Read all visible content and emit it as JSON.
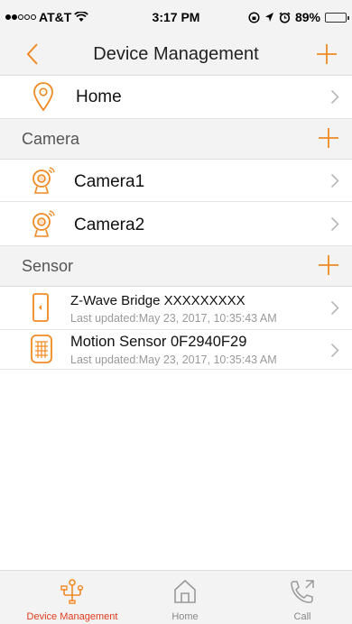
{
  "status": {
    "carrier": "AT&T",
    "time": "3:17 PM",
    "battery": "89%",
    "signal_bars_filled": 2,
    "signal_bars_total": 5,
    "battery_level": 0.89
  },
  "nav": {
    "title": "Device Management",
    "back_icon": "chevron-left-icon",
    "add_icon": "plus-icon"
  },
  "home_row": {
    "label": "Home"
  },
  "camera_section": {
    "title": "Camera",
    "items": [
      {
        "label": "Camera1"
      },
      {
        "label": "Camera2"
      }
    ]
  },
  "sensor_section": {
    "title": "Sensor",
    "items": [
      {
        "name": "Z-Wave Bridge XXXXXXXXX",
        "updated": "Last updated:May 23, 2017, 10:35:43 AM"
      },
      {
        "name": "Motion Sensor 0F2940F29",
        "updated": "Last updated:May 23, 2017, 10:35:43 AM"
      }
    ]
  },
  "tabs": [
    {
      "label": "Device Management",
      "icon": "device-tree-icon",
      "active": true
    },
    {
      "label": "Home",
      "icon": "house-icon",
      "active": false
    },
    {
      "label": "Call",
      "icon": "phone-call-icon",
      "active": false
    }
  ],
  "colors": {
    "accent": "#F08A24",
    "active_tab": "#E23A1E",
    "bar_bg": "#F3F3F3"
  }
}
